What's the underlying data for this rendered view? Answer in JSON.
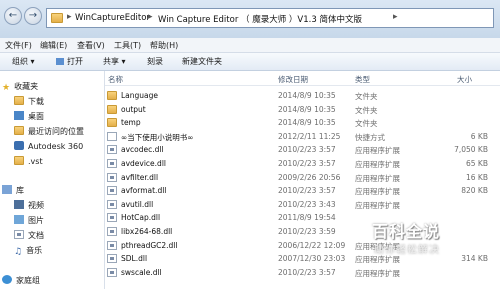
{
  "address": {
    "crumbs": [
      "WinCaptureEditor",
      "Win Capture Editor （ 魔录大师 ）V1.3 简体中文版"
    ],
    "back_icon": "back-arrow-icon",
    "forward_icon": "forward-arrow-icon"
  },
  "menu": [
    "文件(F)",
    "编辑(E)",
    "查看(V)",
    "工具(T)",
    "帮助(H)"
  ],
  "toolbar": {
    "organize": "组织 ▾",
    "open": "打开",
    "share": "共享 ▾",
    "burn": "刻录",
    "new_folder": "新建文件夹"
  },
  "nav": {
    "favorites": "收藏夹",
    "items": [
      "下载",
      "桌面",
      "最近访问的位置",
      "Autodesk 360",
      ".vst"
    ],
    "library": "库",
    "library_items": [
      "视频",
      "图片",
      "文档",
      "音乐"
    ],
    "homegroup": "家庭组"
  },
  "columns": {
    "name": "名称",
    "date": "修改日期",
    "type": "类型",
    "size": "大小"
  },
  "files": [
    {
      "name": "Language",
      "date": "2014/8/9 10:35",
      "type": "文件夹",
      "size": "",
      "icon": "folder-icon"
    },
    {
      "name": "output",
      "date": "2014/8/9 10:35",
      "type": "文件夹",
      "size": "",
      "icon": "folder-icon"
    },
    {
      "name": "temp",
      "date": "2014/8/9 10:35",
      "type": "文件夹",
      "size": "",
      "icon": "folder-icon"
    },
    {
      "name": "∞当下使用小说明书∞",
      "date": "2012/2/11 11:25",
      "type": "快捷方式",
      "size": "6 KB",
      "icon": "shortcut-icon"
    },
    {
      "name": "avcodec.dll",
      "date": "2010/2/23 3:57",
      "type": "应用程序扩展",
      "size": "7,050 KB",
      "icon": "dll-icon"
    },
    {
      "name": "avdevice.dll",
      "date": "2010/2/23 3:57",
      "type": "应用程序扩展",
      "size": "65 KB",
      "icon": "dll-icon"
    },
    {
      "name": "avfilter.dll",
      "date": "2009/2/26 20:56",
      "type": "应用程序扩展",
      "size": "16 KB",
      "icon": "dll-icon"
    },
    {
      "name": "avformat.dll",
      "date": "2010/2/23 3:57",
      "type": "应用程序扩展",
      "size": "820 KB",
      "icon": "dll-icon"
    },
    {
      "name": "avutil.dll",
      "date": "2010/2/23 3:43",
      "type": "应用程序扩展",
      "size": "",
      "icon": "dll-icon"
    },
    {
      "name": "HotCap.dll",
      "date": "2011/8/9 19:54",
      "type": "",
      "size": "",
      "icon": "dll-icon"
    },
    {
      "name": "libx264-68.dll",
      "date": "2010/2/23 3:59",
      "type": "",
      "size": "",
      "icon": "dll-icon"
    },
    {
      "name": "pthreadGC2.dll",
      "date": "2006/12/22 12:09",
      "type": "应用程序扩展",
      "size": "",
      "icon": "dll-icon"
    },
    {
      "name": "SDL.dll",
      "date": "2007/12/30 23:03",
      "type": "应用程序扩展",
      "size": "314 KB",
      "icon": "dll-icon"
    },
    {
      "name": "swscale.dll",
      "date": "2010/2/23 3:57",
      "type": "应用程序扩展",
      "size": "",
      "icon": "dll-icon"
    }
  ],
  "watermark": {
    "title": "百科全说",
    "subtitle": "助你轻松解决"
  }
}
